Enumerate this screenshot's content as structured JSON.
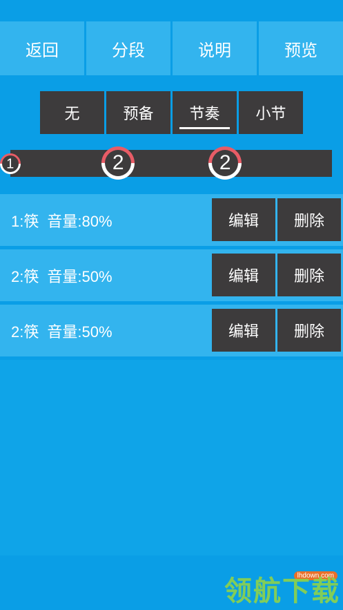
{
  "nav": {
    "back": "返回",
    "segment": "分段",
    "help": "说明",
    "preview": "预览"
  },
  "tabs": [
    {
      "label": "无"
    },
    {
      "label": "预备"
    },
    {
      "label": "节奏",
      "active": true
    },
    {
      "label": "小节"
    }
  ],
  "timeline": {
    "markers": [
      {
        "label": "1"
      },
      {
        "label": "2"
      },
      {
        "label": "2"
      }
    ]
  },
  "rows": [
    {
      "number": "1:筷",
      "volume": "音量:80%",
      "edit": "编辑",
      "delete": "删除"
    },
    {
      "number": "2:筷",
      "volume": "音量:50%",
      "edit": "编辑",
      "delete": "删除"
    },
    {
      "number": "2:筷",
      "volume": "音量:50%",
      "edit": "编辑",
      "delete": "删除"
    }
  ],
  "watermark": {
    "text": "领航下载",
    "site": "lhdown.com"
  },
  "colors": {
    "background": "#0a9ee6",
    "button_light": "#33b4ee",
    "button_dark": "#3d3b3c",
    "marker_red": "#e85c66",
    "text": "#ffffff"
  }
}
